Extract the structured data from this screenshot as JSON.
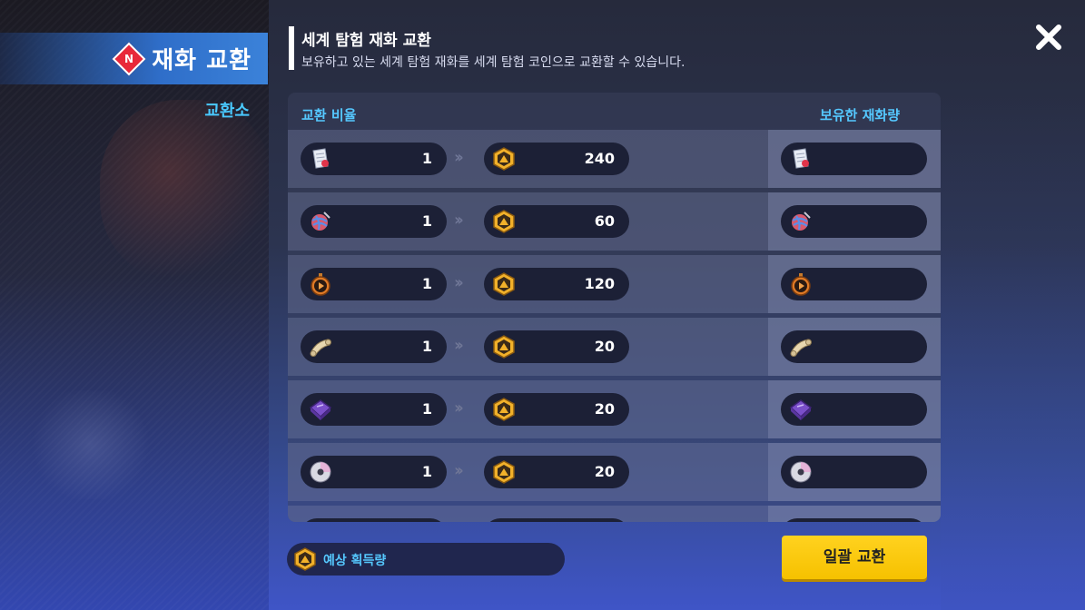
{
  "sidebar": {
    "title": "재화 교환",
    "badge": "N",
    "sub_item": "교환소"
  },
  "panel": {
    "title": "세계 탐험 재화 교환",
    "description": "보유하고 있는 세계 탐험 재화를 세계 탐험 코인으로 교환할 수 있습니다.",
    "col_rate": "교환 비율",
    "col_owned": "보유한 재화량"
  },
  "rows": [
    {
      "item_icon": "paper-note-icon",
      "from_amount": "1",
      "to_amount": "240"
    },
    {
      "item_icon": "yarn-ball-icon",
      "from_amount": "1",
      "to_amount": "60"
    },
    {
      "item_icon": "stopwatch-icon",
      "from_amount": "1",
      "to_amount": "120"
    },
    {
      "item_icon": "scroll-icon",
      "from_amount": "1",
      "to_amount": "20"
    },
    {
      "item_icon": "purple-book-icon",
      "from_amount": "1",
      "to_amount": "20"
    },
    {
      "item_icon": "disc-icon",
      "from_amount": "1",
      "to_amount": "20"
    }
  ],
  "coin_icon": "exploration-coin-icon",
  "arrow_glyph": "››",
  "footer": {
    "estimate_label": "예상 획득량",
    "bulk_button": "일괄 교환"
  },
  "colors": {
    "accent_blue": "#55c8ff",
    "button_yellow": "#ffd21f",
    "badge_red": "#e8283a"
  }
}
